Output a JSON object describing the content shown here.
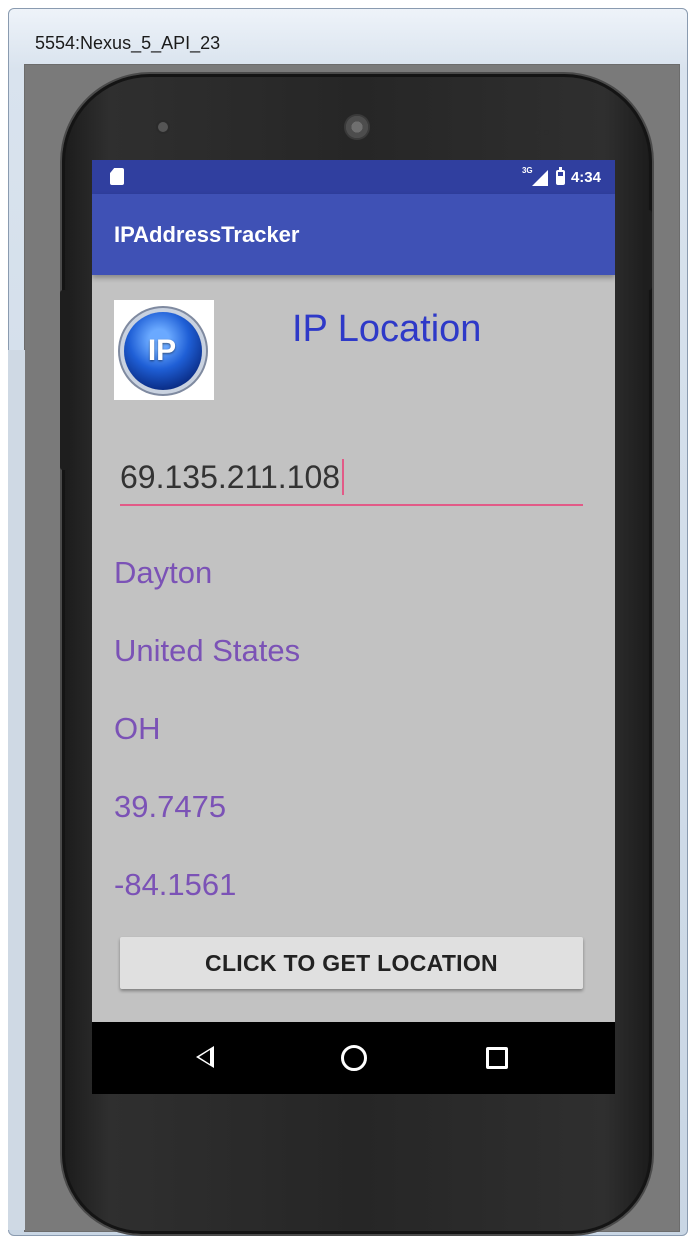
{
  "window": {
    "title": "5554:Nexus_5_API_23"
  },
  "status_bar": {
    "time": "4:34",
    "network": "3G"
  },
  "app_bar": {
    "title": "IPAddressTracker"
  },
  "logo": {
    "text": "IP"
  },
  "heading": "IP Location",
  "ip_input": {
    "value": "69.135.211.108"
  },
  "results": {
    "city": "Dayton",
    "country": "United States",
    "region": "OH",
    "latitude": "39.7475",
    "longitude": "-84.1561"
  },
  "button": {
    "label": "CLICK TO GET LOCATION"
  },
  "colors": {
    "status_bar": "#303f9f",
    "app_bar": "#3f51b5",
    "heading": "#2e39c8",
    "result_text": "#7b52b6",
    "input_underline": "#e25a87",
    "screen_bg": "#c2c2c2"
  },
  "icons": [
    "sd-card-icon",
    "signal-icon",
    "battery-icon",
    "back-icon",
    "home-icon",
    "recents-icon"
  ]
}
